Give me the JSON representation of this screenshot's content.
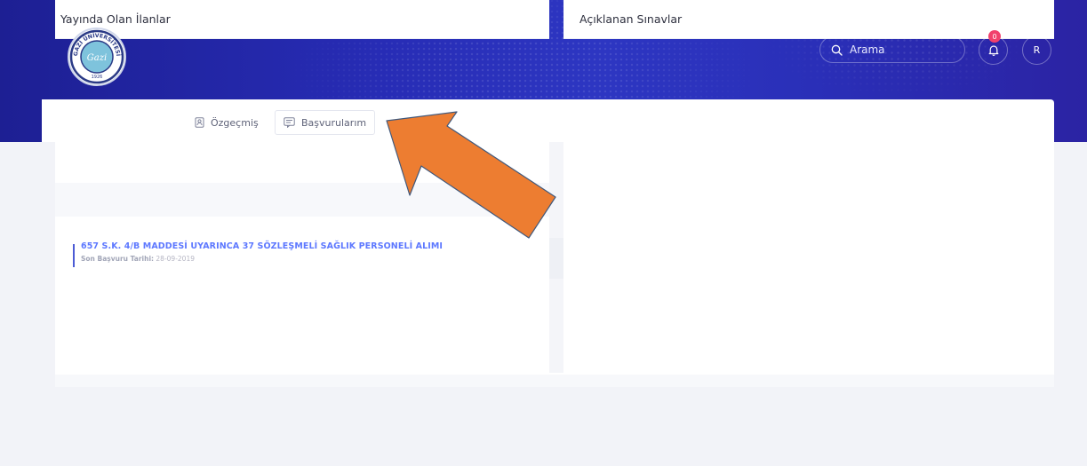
{
  "header": {
    "logo_ring_top": "GAZİ ÜNİVERSİTESİ",
    "logo_script": "Gazi",
    "logo_year": "1926",
    "search_placeholder": "Arama",
    "notification_count": "0",
    "user_icon_letter": "R",
    "icons": [
      "search-icon",
      "bell-icon",
      "user-icon"
    ],
    "colors": {
      "header_start": "#1d1f93",
      "header_end": "#2b23a3",
      "badge": "#f1416c"
    }
  },
  "nav": {
    "tabs": [
      {
        "label": "Özgeçmiş",
        "icon": "cv-icon"
      },
      {
        "label": "Başvurularım",
        "icon": "applications-icon"
      }
    ]
  },
  "left_panel": {
    "title": "Yayında Olan İlanlar",
    "items": [
      {
        "title": "657 S.K. 4/B MADDESİ UYARINCA 37 SÖZLEŞMELİ SAĞLIK PERSONELİ ALIMI",
        "deadline_label": "Son Başvuru Tarihi:",
        "deadline_value": "28-09-2019"
      }
    ]
  },
  "right_panel": {
    "title": "Açıklanan Sınavlar"
  },
  "annotation": {
    "arrow_color": "#ed7d31",
    "arrow_border": "#41597c"
  }
}
